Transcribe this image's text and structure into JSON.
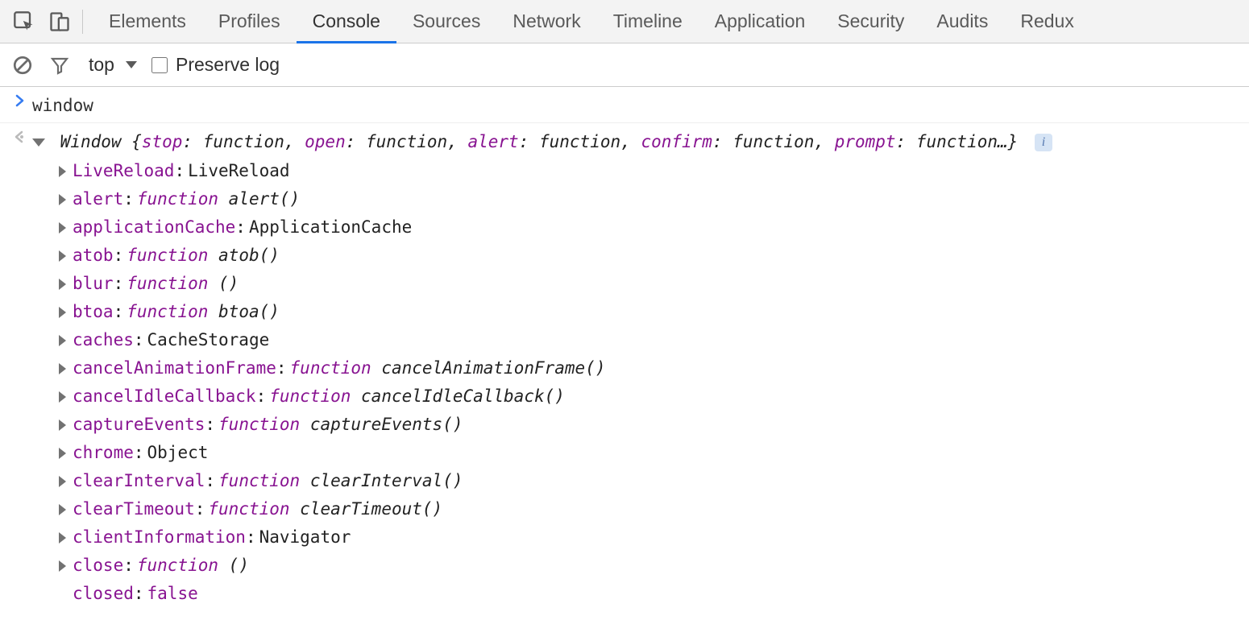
{
  "tabs": [
    {
      "label": "Elements",
      "active": false
    },
    {
      "label": "Profiles",
      "active": false
    },
    {
      "label": "Console",
      "active": true
    },
    {
      "label": "Sources",
      "active": false
    },
    {
      "label": "Network",
      "active": false
    },
    {
      "label": "Timeline",
      "active": false
    },
    {
      "label": "Application",
      "active": false
    },
    {
      "label": "Security",
      "active": false
    },
    {
      "label": "Audits",
      "active": false
    },
    {
      "label": "Redux",
      "active": false
    }
  ],
  "consoleToolbar": {
    "contextLabel": "top",
    "preserveLogLabel": "Preserve log",
    "preserveLogChecked": false
  },
  "input": {
    "text": "window"
  },
  "result": {
    "summary": {
      "typeName": "Window",
      "preview": [
        {
          "key": "stop",
          "val": "function"
        },
        {
          "key": "open",
          "val": "function"
        },
        {
          "key": "alert",
          "val": "function"
        },
        {
          "key": "confirm",
          "val": "function"
        },
        {
          "key": "prompt",
          "val": "function…"
        }
      ],
      "infoBadge": "i"
    },
    "properties": [
      {
        "expandable": true,
        "name": "LiveReload",
        "kind": "obj",
        "value": "LiveReload"
      },
      {
        "expandable": true,
        "name": "alert",
        "kind": "fn",
        "value": "alert()"
      },
      {
        "expandable": true,
        "name": "applicationCache",
        "kind": "obj",
        "value": "ApplicationCache"
      },
      {
        "expandable": true,
        "name": "atob",
        "kind": "fn",
        "value": "atob()"
      },
      {
        "expandable": true,
        "name": "blur",
        "kind": "fn",
        "value": "()"
      },
      {
        "expandable": true,
        "name": "btoa",
        "kind": "fn",
        "value": "btoa()"
      },
      {
        "expandable": true,
        "name": "caches",
        "kind": "obj",
        "value": "CacheStorage"
      },
      {
        "expandable": true,
        "name": "cancelAnimationFrame",
        "kind": "fn",
        "value": "cancelAnimationFrame()"
      },
      {
        "expandable": true,
        "name": "cancelIdleCallback",
        "kind": "fn",
        "value": "cancelIdleCallback()"
      },
      {
        "expandable": true,
        "name": "captureEvents",
        "kind": "fn",
        "value": "captureEvents()"
      },
      {
        "expandable": true,
        "name": "chrome",
        "kind": "obj",
        "value": "Object"
      },
      {
        "expandable": true,
        "name": "clearInterval",
        "kind": "fn",
        "value": "clearInterval()"
      },
      {
        "expandable": true,
        "name": "clearTimeout",
        "kind": "fn",
        "value": "clearTimeout()"
      },
      {
        "expandable": true,
        "name": "clientInformation",
        "kind": "obj",
        "value": "Navigator"
      },
      {
        "expandable": true,
        "name": "close",
        "kind": "fn",
        "value": "()"
      },
      {
        "expandable": false,
        "name": "closed",
        "kind": "bool",
        "value": "false"
      }
    ]
  },
  "fnKeyword": "function"
}
